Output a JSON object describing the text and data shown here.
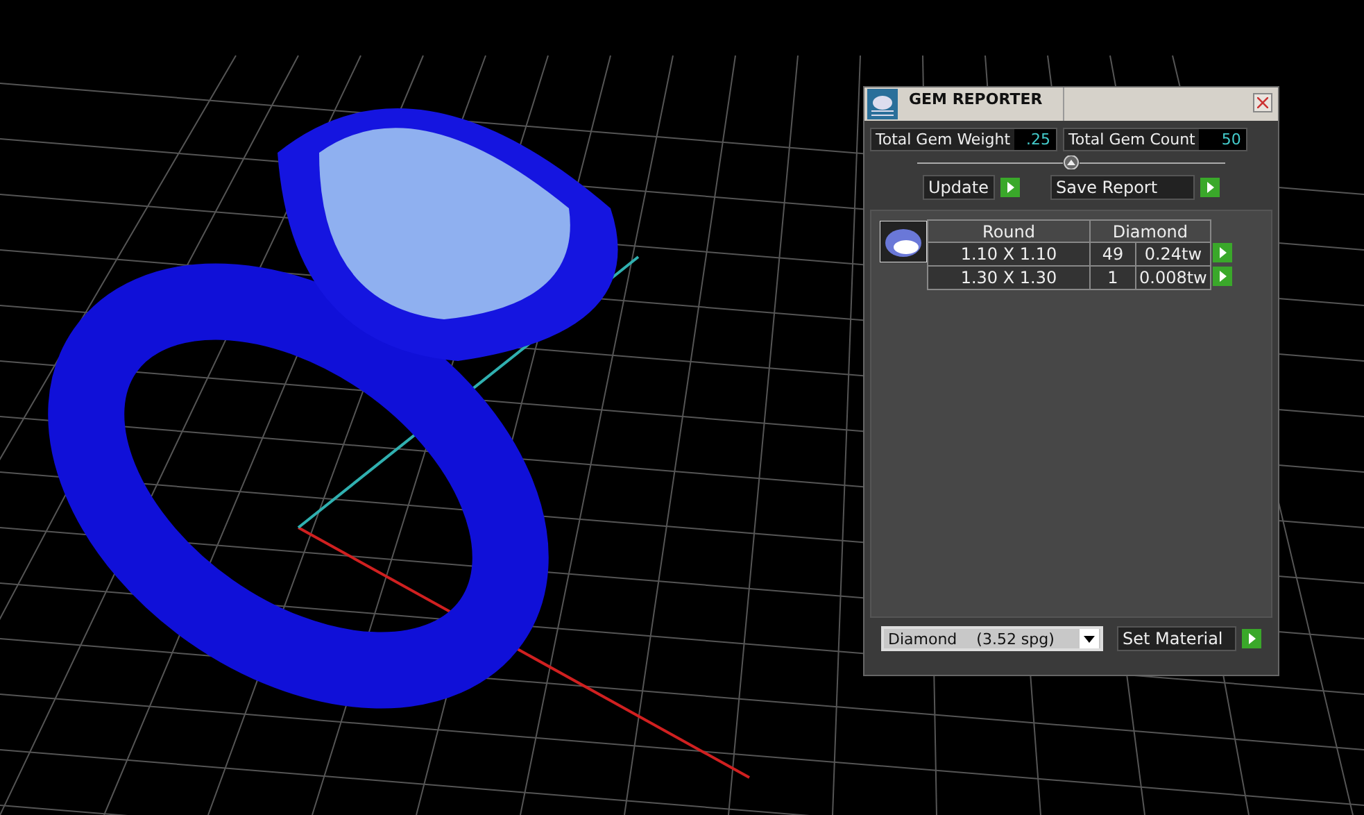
{
  "window": {
    "title": "GEM REPORTER"
  },
  "totals": [
    {
      "label": "Total Gem Weight",
      "value": ".25"
    },
    {
      "label": "Total Gem Count",
      "value": "50"
    }
  ],
  "buttons": [
    "Update",
    "Save Report"
  ],
  "table": {
    "columns": [
      "Round",
      "Diamond"
    ],
    "rows": [
      {
        "size": "1.10 X 1.10",
        "count": "49",
        "weight": "0.24tw"
      },
      {
        "size": "1.30 X 1.30",
        "count": "1",
        "weight": "0.008tw"
      }
    ]
  },
  "material": {
    "value": "Diamond    (3.52 spg)",
    "button": "Set Material"
  }
}
